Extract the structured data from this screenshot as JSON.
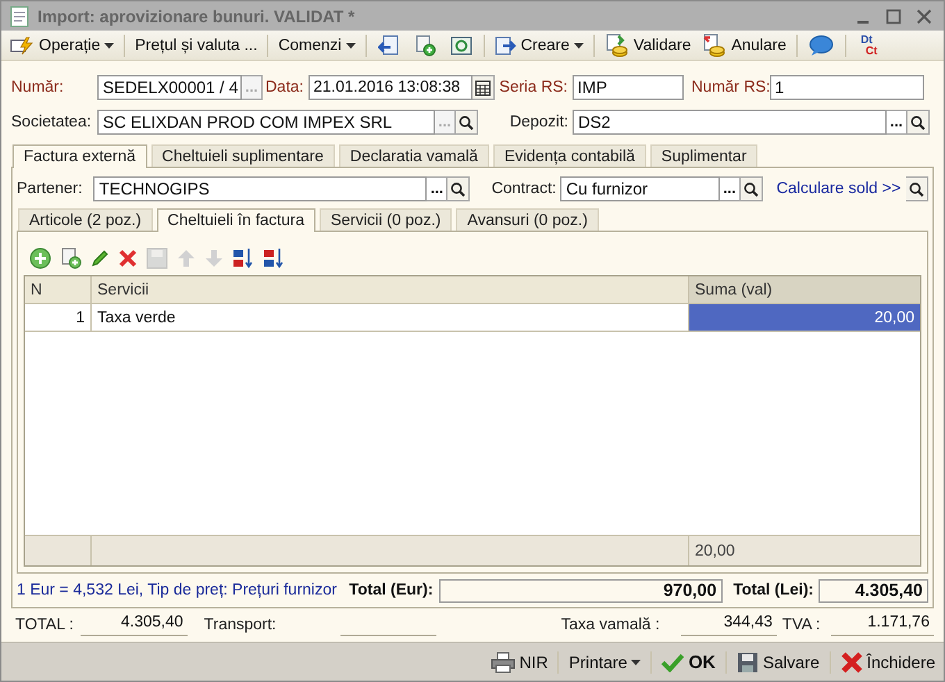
{
  "window": {
    "title": "Import: aprovizionare bunuri. VALIDAT *"
  },
  "toolbar": [
    [
      {
        "kind": "menu",
        "label": "Operație"
      }
    ],
    [
      {
        "kind": "text",
        "label": "Prețul și valuta ..."
      }
    ],
    [
      {
        "kind": "menu",
        "label": "Comenzi"
      }
    ],
    [
      {
        "kind": "icon"
      },
      {
        "kind": "icon"
      },
      {
        "kind": "icon"
      }
    ],
    [
      {
        "kind": "menu",
        "label": "Creare"
      }
    ],
    [
      {
        "kind": "button",
        "label": "Validare"
      },
      {
        "kind": "button",
        "label": "Anulare"
      }
    ],
    [
      {
        "kind": "icon"
      }
    ],
    [
      {
        "kind": "debit-credit",
        "top": "Dt",
        "bottom": "Ct"
      }
    ]
  ],
  "header": {
    "number": {
      "label": "Număr:",
      "value": "SEDELX00001 / 4",
      "browse": "...",
      "browse_disabled": true
    },
    "date": {
      "label": "Data:",
      "value": "21.01.2016 13:08:38"
    },
    "seria_rs": {
      "label": "Seria RS:",
      "value": "IMP"
    },
    "numar_rs": {
      "label": "Număr RS:",
      "value": "1"
    },
    "company": {
      "label": "Societatea:",
      "value": "SC ELIXDAN PROD COM IMPEX SRL",
      "browse": "...",
      "browse_disabled": true
    },
    "warehouse": {
      "label": "Depozit:",
      "value": "DS2",
      "browse": "...",
      "browse_disabled": false
    }
  },
  "tabs": [
    {
      "label": "Factura externă",
      "selected": true
    },
    {
      "label": "Cheltuieli suplimentare",
      "selected": false
    },
    {
      "label": "Declaratia vamală",
      "selected": false
    },
    {
      "label": "Evidența contabilă",
      "selected": false
    },
    {
      "label": "Suplimentar",
      "selected": false
    }
  ],
  "partner": {
    "label": "Partener:",
    "value": "TECHNOGIPS",
    "browse": "...",
    "browse_disabled": false
  },
  "contract": {
    "label": "Contract:",
    "value": "Cu furnizor",
    "browse": "...",
    "browse_disabled": false
  },
  "balance_link": "Calculare sold >>",
  "subtabs": [
    {
      "label": "Articole (2 poz.)",
      "selected": false
    },
    {
      "label": "Cheltuieli în factura",
      "selected": true
    },
    {
      "label": "Servicii (0 poz.)",
      "selected": false
    },
    {
      "label": "Avansuri (0 poz.)",
      "selected": false
    }
  ],
  "grid_toolbar": [
    {
      "disabled": false
    },
    {
      "disabled": false
    },
    {
      "disabled": false
    },
    {
      "disabled": false
    },
    {
      "disabled": true
    },
    {
      "disabled": true
    },
    {
      "disabled": true
    },
    {
      "disabled": false
    },
    {
      "disabled": false
    }
  ],
  "table": {
    "columns": [
      "N",
      "Servicii",
      "Suma (val)"
    ],
    "rows": [
      {
        "n": "1",
        "service": "Taxa verde",
        "amount": "20,00",
        "amount_selected": true
      }
    ],
    "footer_amount": "20,00"
  },
  "rate_info": "1 Eur = 4,532 Lei, Tip de preț: Prețuri furnizor",
  "total_eur": {
    "label": "Total (Eur):",
    "value": "970,00"
  },
  "total_lei": {
    "label": "Total (Lei):",
    "value": "4.305,40"
  },
  "summary": [
    {
      "label": "TOTAL :",
      "value": "4.305,40"
    },
    {
      "label": "Transport:"
    },
    {
      "label": "Taxa vamală :",
      "value": "344,43"
    },
    {
      "label": "TVA :",
      "value": "1.171,76"
    }
  ],
  "bottom_buttons": [
    {
      "kind": "button",
      "label": "NIR"
    },
    {
      "kind": "menu",
      "label": "Printare"
    },
    {
      "kind": "default",
      "label": "OK"
    },
    {
      "kind": "button",
      "label": "Salvare"
    },
    {
      "kind": "button",
      "label": "Închidere"
    }
  ]
}
